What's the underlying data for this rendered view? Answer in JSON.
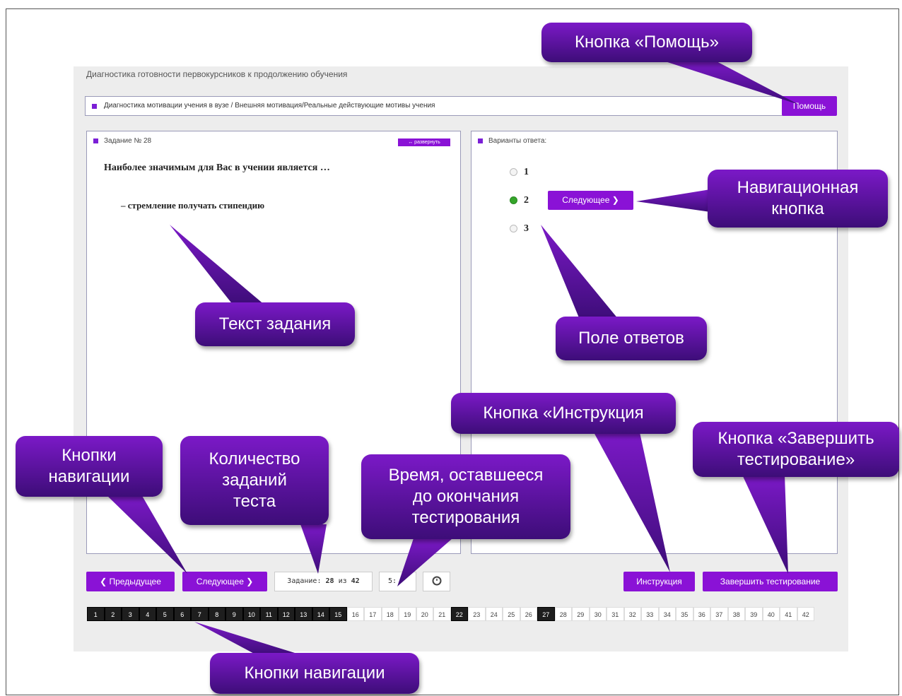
{
  "app": {
    "title": "Диагностика готовности первокурсников к продолжению обучения",
    "breadcrumb": "Диагностика мотивации учения в вузе / Внешняя мотивация/Реальные действующие мотивы учения",
    "help_label": "Помощь"
  },
  "task_panel": {
    "label": "Задание № 28",
    "expand_label": "↔ развернуть",
    "question": "Наиболее значимым для Вас в учении является …",
    "item": "–  стремление получать стипендию"
  },
  "answer_panel": {
    "label": "Варианты ответа:",
    "options": [
      {
        "label": "1",
        "selected": false
      },
      {
        "label": "2",
        "selected": true
      },
      {
        "label": "3",
        "selected": false
      }
    ],
    "next_label": "Следующее ❯"
  },
  "footer": {
    "prev_label": "❮ Предыдущее",
    "next_label": "Следующее ❯",
    "task_counter_prefix": "Задание:",
    "task_current": "28",
    "task_of": "из",
    "task_total": "42",
    "timer": "5:",
    "timer_icon": "clock-icon",
    "instruction_label": "Инструкция",
    "finish_label": "Завершить тестирование"
  },
  "task_numbers": [
    "1",
    "2",
    "3",
    "4",
    "5",
    "6",
    "7",
    "8",
    "9",
    "10",
    "11",
    "12",
    "13",
    "14",
    "15",
    "16",
    "17",
    "18",
    "19",
    "20",
    "21",
    "22",
    "23",
    "24",
    "25",
    "26",
    "27",
    "28",
    "29",
    "30",
    "31",
    "32",
    "33",
    "34",
    "35",
    "36",
    "37",
    "38",
    "39",
    "40",
    "41",
    "42"
  ],
  "answered_numbers": [
    "1",
    "2",
    "3",
    "4",
    "5",
    "6",
    "7",
    "8",
    "9",
    "10",
    "11",
    "12",
    "13",
    "14",
    "15",
    "22",
    "27"
  ],
  "callouts": {
    "help": "Кнопка «Помощь»",
    "nav_button": "Навигационная\nкнопка",
    "task_text": "Текст задания",
    "answers_field": "Поле ответов",
    "instruction": "Кнопка «Инструкция",
    "finish": "Кнопка «Завершить\nтестирование»",
    "nav_buttons": "Кнопки\nнавигации",
    "task_count": "Количество\nзаданий\nтеста",
    "time_left": "Время, оставшееся\nдо окончания\nтестирования",
    "nav_buttons_bottom": "Кнопки  навигации"
  },
  "colors": {
    "accent": "#8a12d6",
    "callout_top": "#7b19c7",
    "callout_bottom": "#3d0d78",
    "selected_radio": "#35a52a",
    "answered_cell": "#1e1e1e"
  }
}
